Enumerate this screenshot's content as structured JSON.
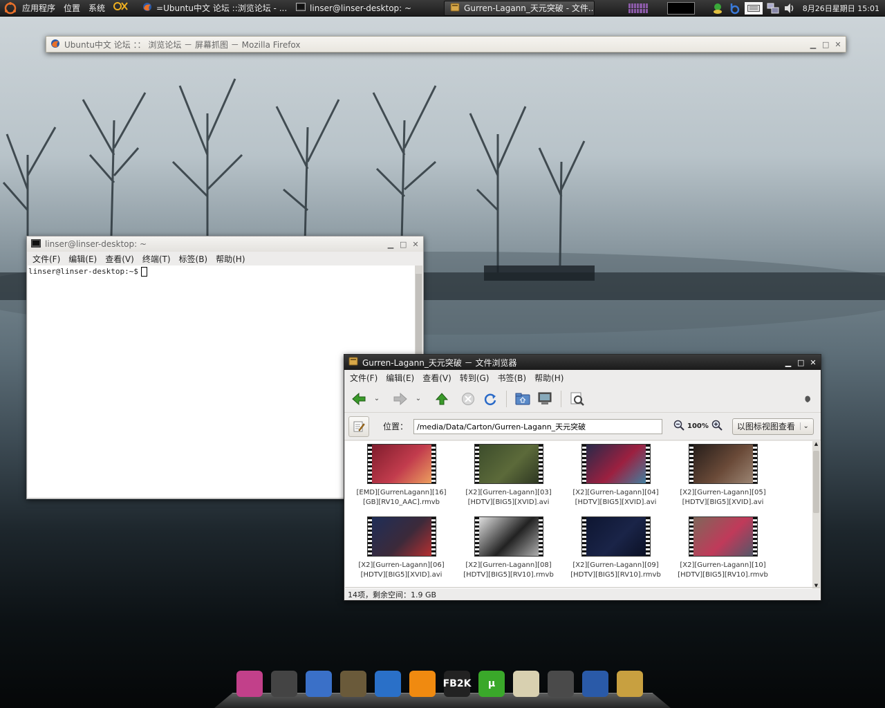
{
  "top_panel": {
    "menus": [
      "应用程序",
      "位置",
      "系统"
    ],
    "tasks": [
      {
        "label": "=Ubuntu中文 论坛 ::浏览论坛 - ...",
        "icon": "firefox-icon"
      },
      {
        "label": "linser@linser-desktop: ~",
        "icon": "terminal-icon"
      },
      {
        "label": "Gurren-Lagann_天元突破 - 文件...",
        "icon": "folder-icon"
      }
    ],
    "clock": "8月26日星期日  15:01"
  },
  "firefox_window": {
    "title": "Ubuntu中文 论坛 ：： 浏览论坛 － 屏幕抓图 － Mozilla Firefox"
  },
  "terminal_window": {
    "title": "linser@linser-desktop: ~",
    "menus": [
      "文件(F)",
      "编辑(E)",
      "查看(V)",
      "终端(T)",
      "标签(B)",
      "帮助(H)"
    ],
    "prompt": "linser@linser-desktop:~$"
  },
  "file_manager": {
    "title": "Gurren-Lagann_天元突破 － 文件浏览器",
    "menus": [
      "文件(F)",
      "编辑(E)",
      "查看(V)",
      "转到(G)",
      "书签(B)",
      "帮助(H)"
    ],
    "location_label": "位置：",
    "location_value": "/media/Data/Carton/Gurren-Lagann_天元突破",
    "zoom": "100%",
    "view_mode": "以图标视图查看",
    "files": [
      {
        "line1": "[EMD][GurrenLagann][16]",
        "line2": "[GB][RV10_AAC].rmvb",
        "colors": [
          "#7a1a2a",
          "#c23c4d",
          "#f0a860"
        ]
      },
      {
        "line1": "[X2][Gurren-Lagann][03]",
        "line2": "[HDTV][BIG5][XVID].avi",
        "colors": [
          "#3a4a2a",
          "#5c6a3a",
          "#2a3320"
        ]
      },
      {
        "line1": "[X2][Gurren-Lagann][04]",
        "line2": "[HDTV][BIG5][XVID].avi",
        "colors": [
          "#1f2a4a",
          "#9c2040",
          "#3a88a8"
        ]
      },
      {
        "line1": "[X2][Gurren-Lagann][05]",
        "line2": "[HDTV][BIG5][XVID].avi",
        "colors": [
          "#201a18",
          "#6a4a38",
          "#a08a78"
        ]
      },
      {
        "line1": "[X2][Gurren-Lagann][06]",
        "line2": "[HDTV][BIG5][XVID].avi",
        "colors": [
          "#1c2e5a",
          "#3c2a3a",
          "#c03030"
        ]
      },
      {
        "line1": "[X2][Gurren-Lagann][08]",
        "line2": "[HDTV][BIG5][RV10].rmvb",
        "colors": [
          "#eeeeee",
          "#222222",
          "#bbbbbb"
        ]
      },
      {
        "line1": "[X2][Gurren-Lagann][09]",
        "line2": "[HDTV][BIG5][RV10].rmvb",
        "colors": [
          "#0d1530",
          "#1a2448",
          "#0a0f22"
        ]
      },
      {
        "line1": "[X2][Gurren-Lagann][10]",
        "line2": "[HDTV][BIG5][RV10].rmvb",
        "colors": [
          "#7a6a5a",
          "#c03a5a",
          "#4a5a6a"
        ]
      }
    ],
    "status": "14项，剩余空间：1.9 GB"
  },
  "dock": {
    "icons": [
      {
        "name": "theme-icon",
        "color": "#c2408a"
      },
      {
        "name": "terminal-icon",
        "color": "#444444"
      },
      {
        "name": "pidgin-icon",
        "color": "#3a70c8"
      },
      {
        "name": "gimp-icon",
        "color": "#6a5a3a"
      },
      {
        "name": "firefox-icon",
        "color": "#2a70c8"
      },
      {
        "name": "settings-icon",
        "color": "#f08a10"
      },
      {
        "name": "fb2k-icon",
        "color": "#222222",
        "label": "FB2K"
      },
      {
        "name": "utorrent-icon",
        "color": "#3aa82a",
        "label": "µ"
      },
      {
        "name": "text-editor-icon",
        "color": "#d8d0b0"
      },
      {
        "name": "calculator-icon",
        "color": "#4a4a4a"
      },
      {
        "name": "bookmark-icon",
        "color": "#2a5aa8"
      },
      {
        "name": "file-manager-icon",
        "color": "#c8a040"
      }
    ]
  }
}
